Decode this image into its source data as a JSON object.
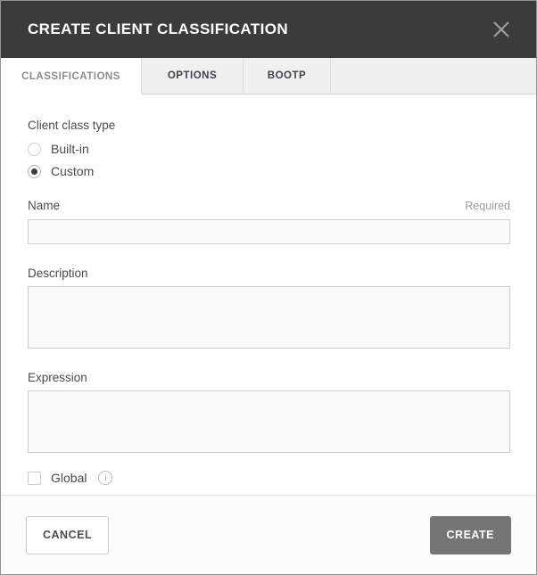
{
  "dialog": {
    "title": "CREATE CLIENT CLASSIFICATION"
  },
  "icons": {
    "close": "x-icon",
    "info_glyph": "i"
  },
  "tabs": [
    {
      "label": "CLASSIFICATIONS",
      "active": true
    },
    {
      "label": "OPTIONS",
      "active": false
    },
    {
      "label": "BOOTP",
      "active": false
    }
  ],
  "form": {
    "client_class_type": {
      "label": "Client class type",
      "options": [
        {
          "label": "Built-in",
          "selected": false
        },
        {
          "label": "Custom",
          "selected": true
        }
      ]
    },
    "name": {
      "label": "Name",
      "required_hint": "Required",
      "value": ""
    },
    "description": {
      "label": "Description",
      "value": ""
    },
    "expression": {
      "label": "Expression",
      "value": ""
    },
    "global": {
      "label": "Global",
      "checked": false
    }
  },
  "footer": {
    "cancel_label": "CANCEL",
    "create_label": "CREATE"
  },
  "colors": {
    "header_bg": "#3b3b3b",
    "tab_bar_bg": "#f0f0f0",
    "active_tab_text": "#8b8b94",
    "inactive_tab_text": "#41414d",
    "field_bg": "#fafafa",
    "field_border": "#cccccc",
    "create_button_bg": "#757575",
    "label_text": "#4c4c4c"
  }
}
